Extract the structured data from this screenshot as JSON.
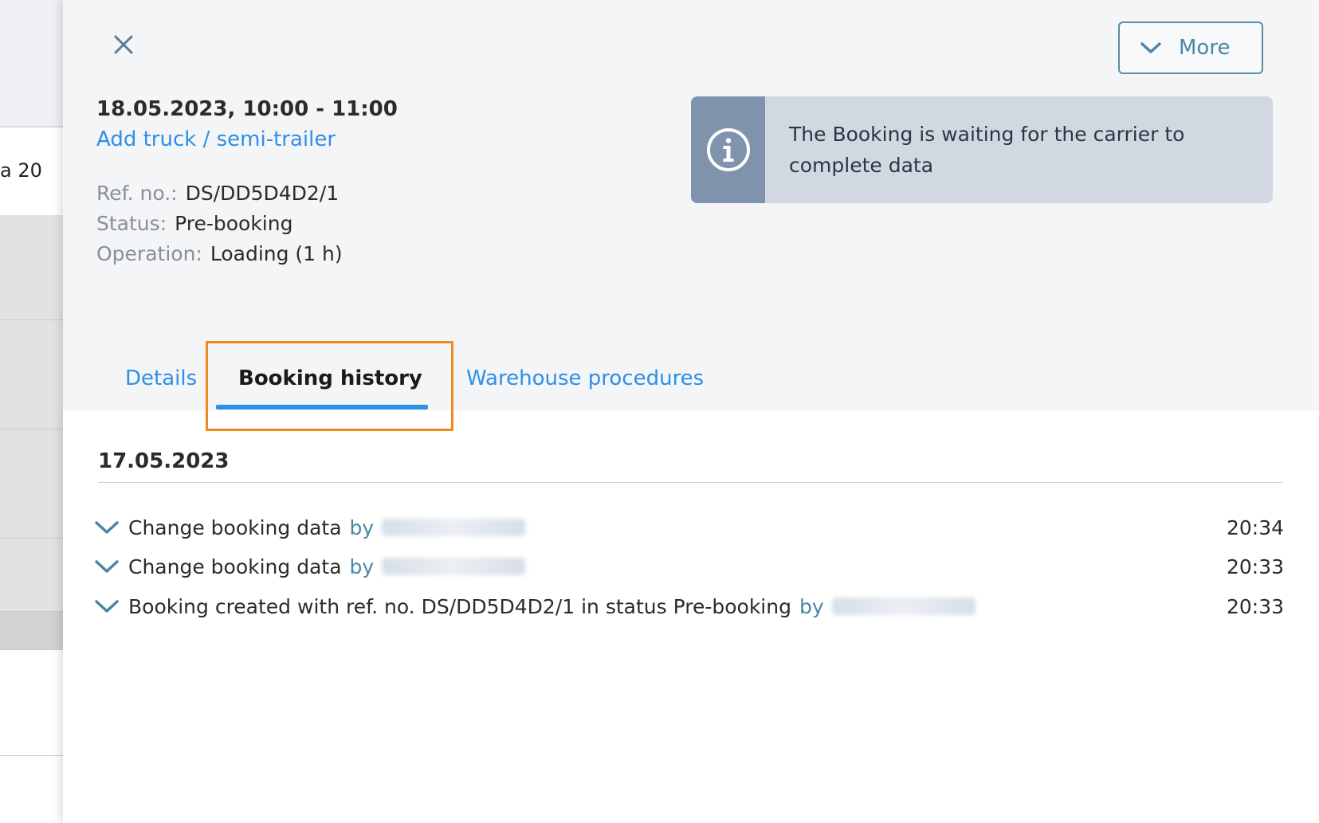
{
  "background": {
    "cell_text": "a 20"
  },
  "header": {
    "more_label": "More",
    "title": "18.05.2023, 10:00 - 11:00",
    "add_truck_link": "Add truck / semi-trailer",
    "ref_label": "Ref. no.:",
    "ref_value": "DS/DD5D4D2/1",
    "status_label": "Status:",
    "status_value": "Pre-booking",
    "operation_label": "Operation:",
    "operation_value": "Loading (1 h)",
    "info_message": "The Booking is waiting for the carrier to complete data"
  },
  "tabs": [
    {
      "label": "Details",
      "active": false
    },
    {
      "label": "Booking history",
      "active": true
    },
    {
      "label": "Warehouse procedures",
      "active": false
    }
  ],
  "history": {
    "date": "17.05.2023",
    "entries": [
      {
        "text": "Change booking data",
        "by": "by",
        "time": "20:34"
      },
      {
        "text": "Change booking data",
        "by": "by",
        "time": "20:33"
      },
      {
        "text": "Booking created with ref. no. DS/DD5D4D2/1 in status Pre-booking",
        "by": "by",
        "time": "20:33"
      }
    ]
  },
  "colors": {
    "accent": "#2f8fe6",
    "highlight": "#f0891f",
    "info_icon_bg": "#7f93ac",
    "info_bg": "#d1d8e1"
  }
}
